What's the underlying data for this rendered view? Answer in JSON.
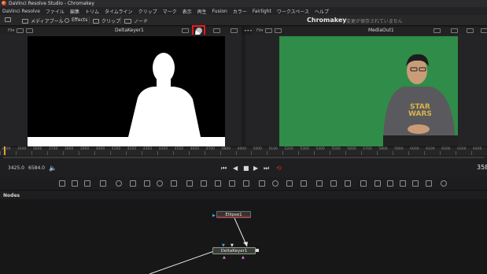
{
  "window": {
    "title": "DaVinci Resolve Studio - Chromakey"
  },
  "menu": [
    "DaVinci Resolve",
    "ファイル",
    "編集",
    "トリム",
    "タイムライン",
    "クリップ",
    "マーク",
    "表示",
    "再生",
    "Fusion",
    "カラー",
    "Fairlight",
    "ワークスペース",
    "ヘルプ"
  ],
  "toolbar": {
    "media_pool": "メディアプール",
    "effects": "Effects",
    "clips": "クリップ",
    "nodes": "ノード",
    "project_title": "Chromakey",
    "saved_status": "変更が保存されていません"
  },
  "left_viewer": {
    "fit": "Fit",
    "title": "DeltaKeyer1"
  },
  "right_viewer": {
    "fit": "Fit",
    "title": "MediaOut1"
  },
  "ruler": {
    "ticks": [
      "3400",
      "3500",
      "3600",
      "3700",
      "3800",
      "3900",
      "4000",
      "4100",
      "4200",
      "4300",
      "4400",
      "4500",
      "4600",
      "4700",
      "4800",
      "4900",
      "5000",
      "5100",
      "5200",
      "5300",
      "5400",
      "5500",
      "5600",
      "5700",
      "5800",
      "5900",
      "6000",
      "6100",
      "6200",
      "6300",
      "6400"
    ]
  },
  "transport": {
    "in_time": "3425.0",
    "out_time": "6584.0",
    "current_frame": "358"
  },
  "nodes_panel": {
    "label": "Nodes",
    "nodes": [
      {
        "name": "Ellipse1"
      },
      {
        "name": "DeltaKeyer1"
      }
    ]
  },
  "colors": {
    "green_screen": "#2f8c49",
    "highlight": "#e31b1b",
    "loop": "#e42b2b"
  },
  "icons": [
    "search-icon",
    "mask-icon",
    "play-icon",
    "stop-icon",
    "loop-icon",
    "volume-icon"
  ]
}
